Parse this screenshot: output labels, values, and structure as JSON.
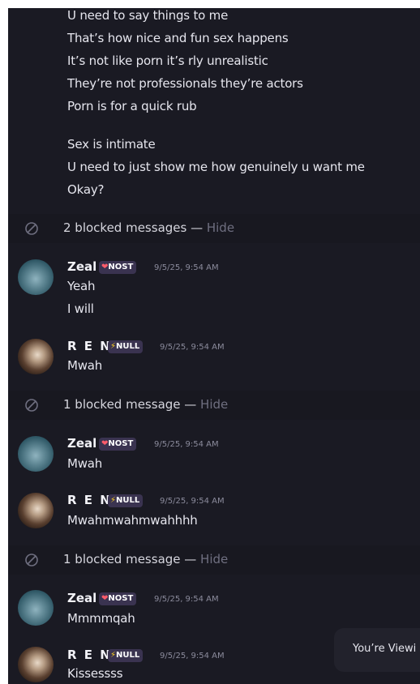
{
  "top_message_lines": [
    "U need to say things to me",
    "That’s how nice and fun sex happens",
    "It’s not like porn it’s rly unrealistic",
    "They’re not professionals they’re actors",
    "Porn is for a quick rub",
    "Sex is intimate",
    "U need to just show me how genuinely u want me",
    "Okay?"
  ],
  "blocked_groups": [
    {
      "text": "2 blocked messages — ",
      "hide": "Hide"
    },
    {
      "text": "1 blocked message — ",
      "hide": "Hide"
    },
    {
      "text": "1 blocked message — ",
      "hide": "Hide"
    }
  ],
  "messages": [
    {
      "user": "Zeal",
      "tag": "NOST",
      "tag_icon": "❤",
      "time": "9/5/25, 9:54 AM",
      "lines": [
        "Yeah",
        "I will"
      ]
    },
    {
      "user": "R E N",
      "tag": "NULL",
      "tag_icon": "⚡",
      "time": "9/5/25, 9:54 AM",
      "lines": [
        "Mwah"
      ]
    },
    {
      "user": "Zeal",
      "tag": "NOST",
      "tag_icon": "❤",
      "time": "9/5/25, 9:54 AM",
      "lines": [
        "Mwah"
      ]
    },
    {
      "user": "R E N",
      "tag": "NULL",
      "tag_icon": "⚡",
      "time": "9/5/25, 9:54 AM",
      "lines": [
        "Mwahmwahmwahhhh"
      ]
    },
    {
      "user": "Zeal",
      "tag": "NOST",
      "tag_icon": "❤",
      "time": "9/5/25, 9:54 AM",
      "lines": [
        "Mmmmqah"
      ]
    },
    {
      "user": "R E N",
      "tag": "NULL",
      "tag_icon": "⚡",
      "time": "9/5/25, 9:54 AM",
      "lines": [
        "Kissessss"
      ]
    }
  ],
  "toast": {
    "text": "You’re Viewi"
  },
  "colors": {
    "background": "#1a1a23",
    "blocked_row": "#181820",
    "muted": "#6f6f80",
    "nost_icon": "#ff5c6b",
    "null_icon": "#ffd21f"
  }
}
